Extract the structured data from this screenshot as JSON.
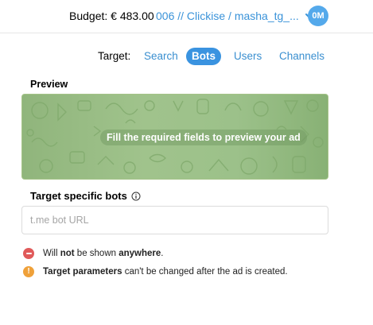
{
  "header": {
    "budget_label": "Budget: € 483.00",
    "account_label": "006 // Clickise / masha_tg_...",
    "avatar_initials": "0M",
    "avatar_color": "#54a9eb"
  },
  "target": {
    "label": "Target:",
    "tabs": [
      {
        "label": "Search",
        "active": false
      },
      {
        "label": "Bots",
        "active": true
      },
      {
        "label": "Users",
        "active": false
      },
      {
        "label": "Channels",
        "active": false
      }
    ],
    "accent_color": "#3a93e0"
  },
  "preview": {
    "title": "Preview",
    "message": "Fill the required fields to preview your ad"
  },
  "bots": {
    "title": "Target specific bots",
    "placeholder": "t.me bot URL"
  },
  "notes": {
    "n1_pre": "Will ",
    "n1_b1": "not",
    "n1_mid": " be shown ",
    "n1_b2": "anywhere",
    "n1_post": ".",
    "n2_b": "Target parameters",
    "n2_post": " can't be changed after the ad is created."
  }
}
